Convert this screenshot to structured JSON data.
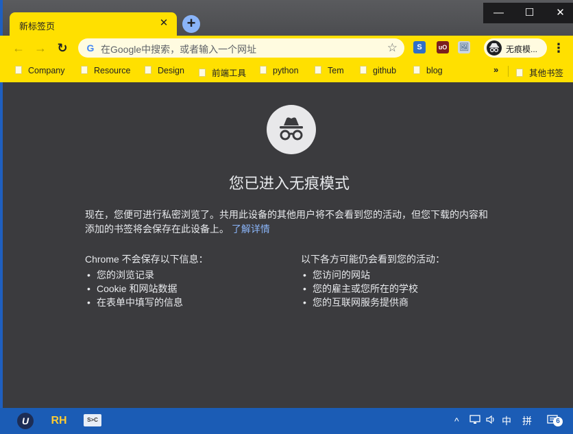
{
  "tab": {
    "title": "新标签页",
    "close": "✕",
    "new_tab": "+"
  },
  "window_controls": {
    "minimize": "—",
    "maximize": "☐",
    "close": "✕"
  },
  "toolbar": {
    "back": "←",
    "forward": "→",
    "reload": "↻",
    "omnibox_placeholder": "在Google中搜索，或者输入一个网址",
    "google_glyph": "G",
    "star": "☆",
    "profile_label": "无痕模...",
    "menu": "⋮",
    "extensions": [
      "S",
      "uO",
      "🖼"
    ]
  },
  "bookmarks": {
    "items": [
      "Company",
      "Resource",
      "Design",
      "前端工具",
      "python",
      "Tem",
      "github",
      "blog"
    ],
    "overflow": "»",
    "other": "其他书签"
  },
  "incognito": {
    "heading": "您已进入无痕模式",
    "intro": "现在，您便可进行私密浏览了。共用此设备的其他用户将不会看到您的活动，但您下载的内容和添加的书签将会保存在此设备上。",
    "learn_more": "了解详情",
    "not_saved_title": "Chrome 不会保存以下信息：",
    "not_saved_items": [
      "您的浏览记录",
      "Cookie 和网站数据",
      "在表单中填写的信息"
    ],
    "visible_title": "以下各方可能仍会看到您的活动：",
    "visible_items": [
      "您访问的网站",
      "您的雇主或您所在的学校",
      "您的互联网服务提供商"
    ]
  },
  "taskbar": {
    "apps": [
      "U",
      "RH",
      "S>C"
    ],
    "tray": {
      "chevron": "^",
      "ime": "中",
      "ime2": "拼",
      "notifications_count": "6"
    }
  }
}
